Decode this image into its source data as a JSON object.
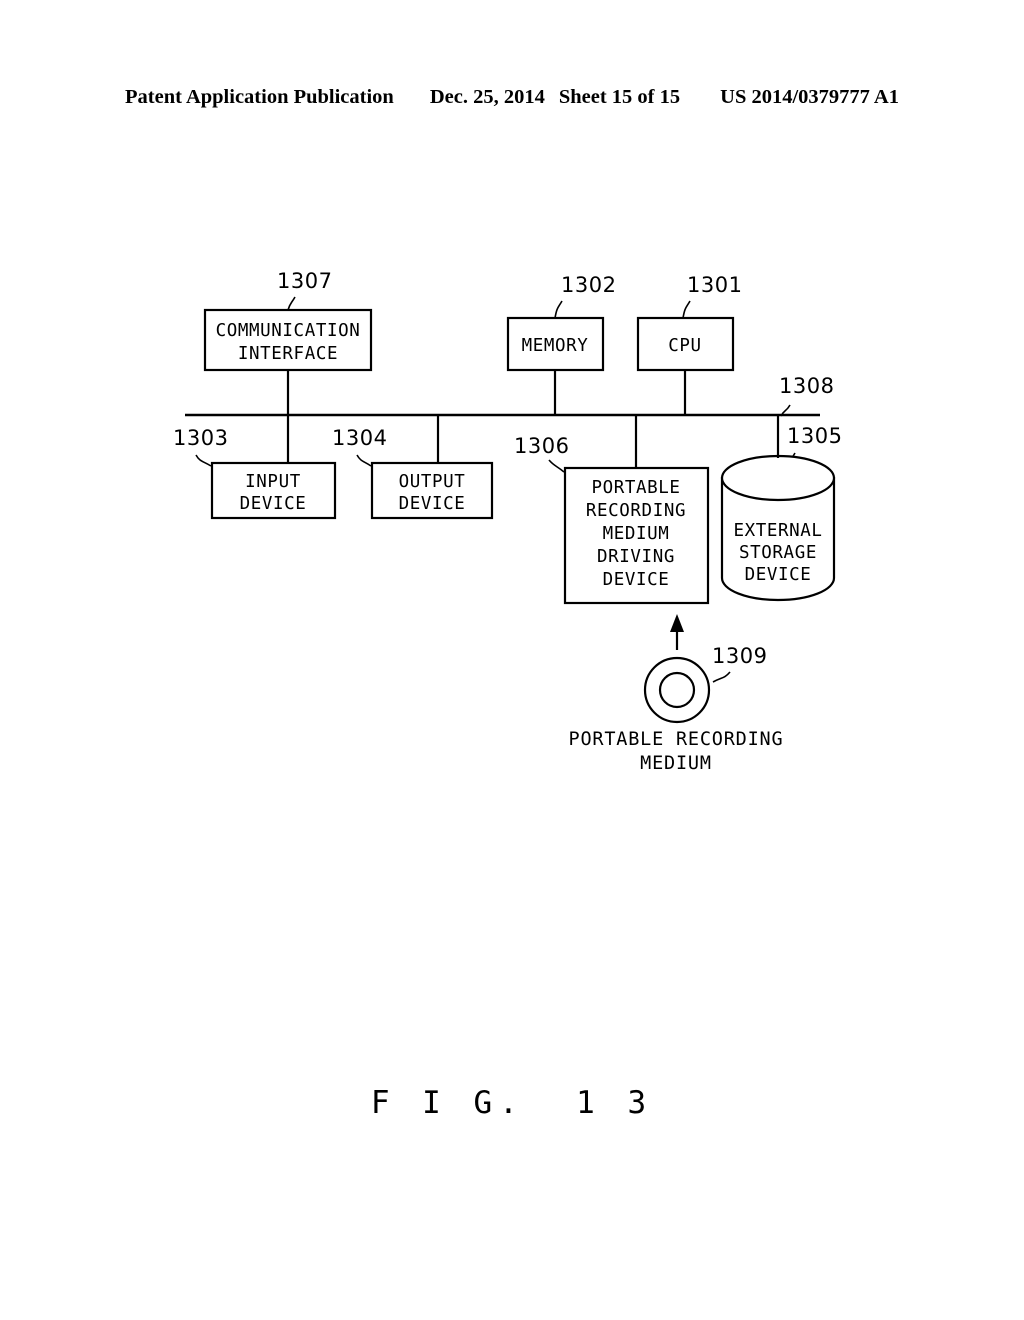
{
  "header": {
    "publication": "Patent Application Publication",
    "date": "Dec. 25, 2014",
    "sheet": "Sheet 15 of 15",
    "patent_number": "US 2014/0379777 A1"
  },
  "figure": {
    "caption": "F I G.  1 3",
    "blocks": {
      "communication_interface": {
        "line1": "COMMUNICATION",
        "line2": "INTERFACE",
        "ref": "1307"
      },
      "memory": {
        "line1": "MEMORY",
        "ref": "1302"
      },
      "cpu": {
        "line1": "CPU",
        "ref": "1301"
      },
      "input_device": {
        "line1": "INPUT",
        "line2": "DEVICE",
        "ref": "1303"
      },
      "output_device": {
        "line1": "OUTPUT",
        "line2": "DEVICE",
        "ref": "1304"
      },
      "portable_recording_medium_driving_device": {
        "line1": "PORTABLE",
        "line2": "RECORDING",
        "line3": "MEDIUM",
        "line4": "DRIVING",
        "line5": "DEVICE",
        "ref": "1306"
      },
      "external_storage_device": {
        "line1": "EXTERNAL",
        "line2": "STORAGE",
        "line3": "DEVICE",
        "ref": "1305"
      },
      "portable_recording_medium": {
        "caption_line1": "PORTABLE RECORDING",
        "caption_line2": "MEDIUM",
        "ref": "1309"
      },
      "bus": {
        "ref": "1308"
      }
    }
  },
  "colors": {
    "ink": "#000000",
    "paper": "#ffffff"
  }
}
